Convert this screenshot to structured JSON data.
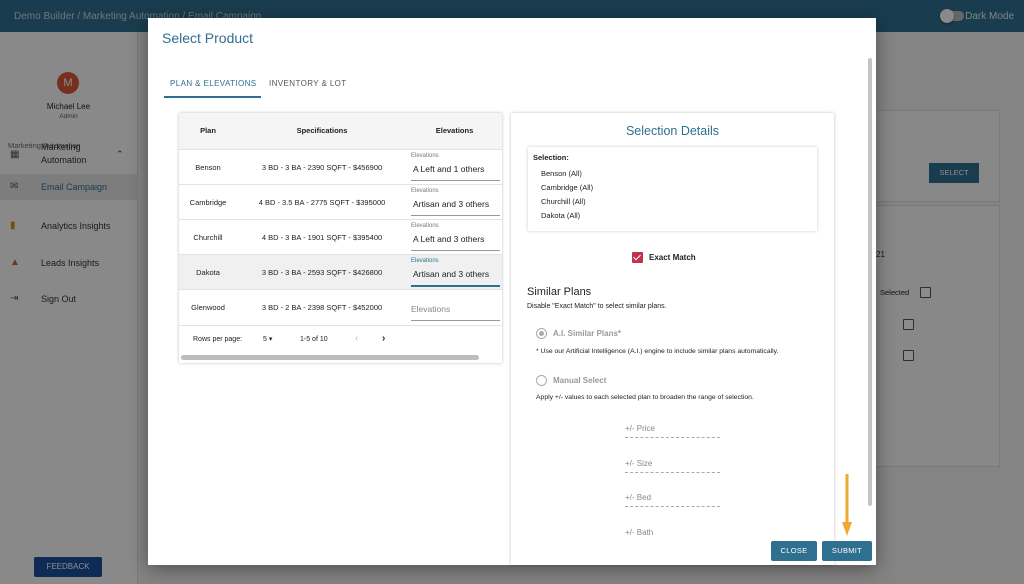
{
  "topbar": {
    "breadcrumb": "Demo Builder  /  Marketing Automation / Email Campaign",
    "dark_mode_label": "Dark Mode"
  },
  "sidebar": {
    "avatar_initial": "M",
    "user_name": "Michael Lee",
    "user_role": "Admin",
    "section_label": "Marketing Automation",
    "items": [
      {
        "label": "Marketing Automation",
        "icon": "clipboard-icon"
      },
      {
        "label": "Email Campaign",
        "icon": "mail-icon"
      },
      {
        "label": "Analytics Insights",
        "icon": "analytics-icon"
      },
      {
        "label": "Leads Insights",
        "icon": "leads-icon"
      },
      {
        "label": "Sign Out",
        "icon": "sign-out-icon"
      }
    ],
    "feedback_label": "FEEDBACK"
  },
  "background": {
    "select_label": "SELECT",
    "selected_header": "Selected",
    "partial_value": "21"
  },
  "modal": {
    "title": "Select Product",
    "tabs": [
      "PLAN & ELEVATIONS",
      "INVENTORY & LOT"
    ],
    "table": {
      "headers": [
        "Plan",
        "Specifications",
        "Elevations"
      ],
      "elevations_label": "Elevations",
      "rows": [
        {
          "plan": "Benson",
          "spec": "3 BD - 3 BA - 2390 SQFT - $456900",
          "elevation": "A Left and 1 others"
        },
        {
          "plan": "Cambridge",
          "spec": "4 BD - 3.5 BA - 2775 SQFT - $395000",
          "elevation": "Artisan and 3 others"
        },
        {
          "plan": "Churchill",
          "spec": "4 BD - 3 BA - 1901 SQFT - $395400",
          "elevation": "A Left and 3 others"
        },
        {
          "plan": "Dakota",
          "spec": "3 BD - 3 BA - 2593 SQFT - $426800",
          "elevation": "Artisan and 3 others"
        },
        {
          "plan": "Glenwood",
          "spec": "3 BD - 2 BA - 2398 SQFT - $452000",
          "elevation": ""
        }
      ],
      "rows_per_page_label": "Rows per page:",
      "rows_per_page": "5",
      "page_info": "1-5 of 10"
    },
    "selection": {
      "title": "Selection Details",
      "label": "Selection:",
      "items": [
        "Benson (All)",
        "Cambridge (All)",
        "Churchill (All)",
        "Dakota (All)"
      ],
      "exact_match_label": "Exact Match",
      "similar_title": "Similar Plans",
      "similar_desc": "Disable \"Exact Match\" to select similar plans.",
      "ai_label": "A.I. Similar Plans*",
      "ai_note": "* Use our Artificial Intelligence (A.I.) engine to include similar plans automatically.",
      "manual_label": "Manual Select",
      "manual_note": "Apply +/- values to each selected plan to broaden the range of selection.",
      "fields": [
        "+/- Price",
        "+/- Size",
        "+/- Bed",
        "+/- Bath"
      ]
    },
    "close_label": "CLOSE",
    "submit_label": "SUBMIT"
  },
  "colors": {
    "accent": "#2f6f8f",
    "checkbox": "#c2314e",
    "arrow": "#f0a830"
  }
}
